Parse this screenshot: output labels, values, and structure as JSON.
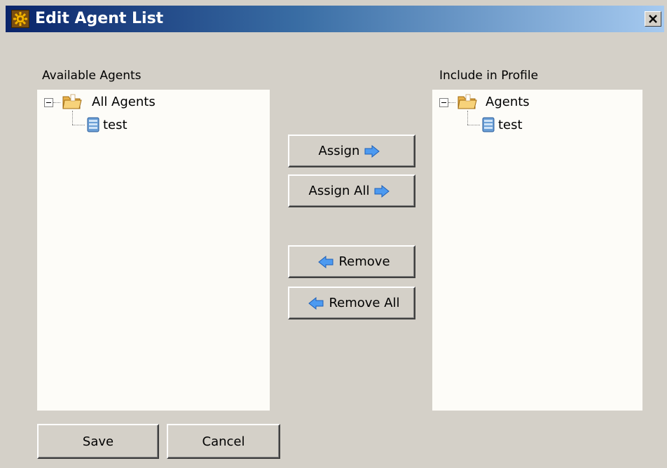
{
  "window": {
    "title": "Edit Agent List",
    "icon": "gear-icon",
    "close_icon": "close-icon"
  },
  "available": {
    "label": "Available Agents",
    "tree": {
      "root": {
        "label": "All Agents",
        "icon": "folder-icon",
        "expanded": true
      },
      "children": [
        {
          "label": "test",
          "icon": "agent-server-icon"
        }
      ]
    }
  },
  "included": {
    "label": "Include in Profile",
    "tree": {
      "root": {
        "label": "Agents",
        "icon": "folder-icon",
        "expanded": true
      },
      "children": [
        {
          "label": "test",
          "icon": "agent-server-icon"
        }
      ]
    }
  },
  "actions": {
    "assign": "Assign",
    "assign_all": "Assign All",
    "remove": "Remove",
    "remove_all": "Remove All",
    "assign_icon": "arrow-right-icon",
    "remove_icon": "arrow-left-icon"
  },
  "footer": {
    "save": "Save",
    "cancel": "Cancel"
  },
  "colors": {
    "title_gradient_start": "#0a246a",
    "title_gradient_end": "#a6caf0",
    "window_bg": "#d4d0c8",
    "panel_bg": "#fdfcf8",
    "arrow_blue": "#2f7fe0"
  }
}
